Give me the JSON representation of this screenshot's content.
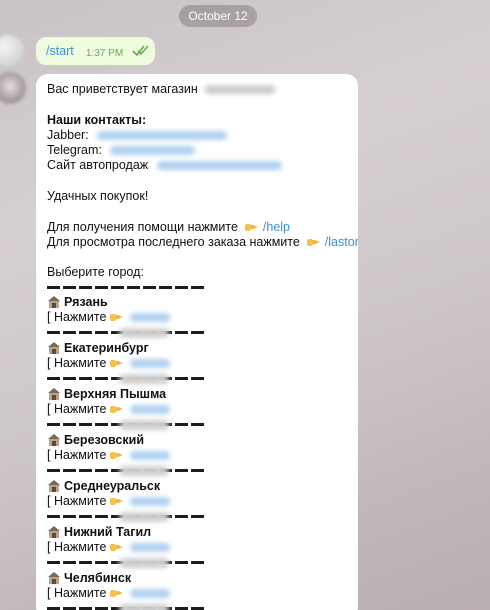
{
  "date_label": "October 12",
  "outgoing": {
    "text": "/start",
    "time": "1:37 PM"
  },
  "incoming": {
    "welcome": "Вас приветствует магазин",
    "contacts_title": "Наши контакты:",
    "jabber_label": "Jabber:",
    "telegram_label": "Telegram:",
    "site_label": "Сайт автопродаж",
    "good_luck": "Удачных покупок!",
    "help_text": "Для получения помощи нажмите",
    "help_cmd": "/help",
    "lastorder_text": "Для просмотра последнего заказа нажмите",
    "lastorder_cmd": "/lastorder",
    "choose_city": "Выберите город:",
    "press_label": "[ Нажмите",
    "cities": [
      "Рязань",
      "Екатеринбург",
      "Верхняя Пышма",
      "Березовский",
      "Среднеуральск",
      "Нижний Тагил",
      "Челябинск"
    ]
  },
  "icons": {
    "check": "double-check-icon",
    "hand": "pointing-hand-icon",
    "city": "house-icon"
  },
  "colors": {
    "outgoing_bubble": "#effdde",
    "link": "#3a8fd6",
    "time_outgoing": "#5fae53"
  }
}
